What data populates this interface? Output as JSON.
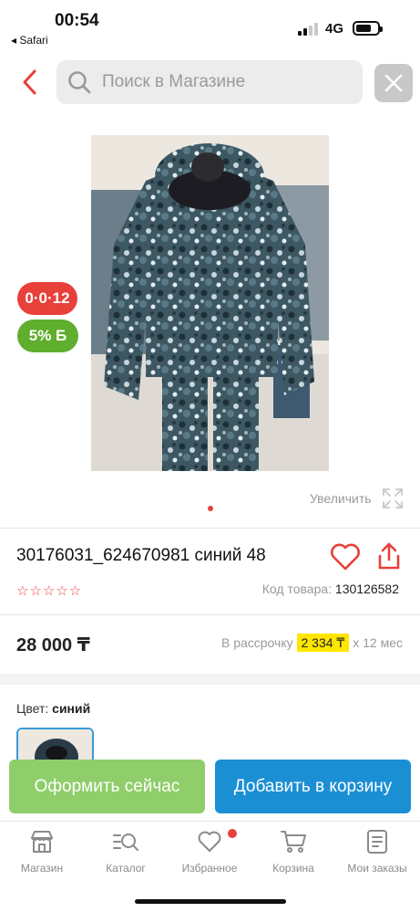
{
  "status_bar": {
    "time": "00:54",
    "back_app": "◂ Safari",
    "network": "4G"
  },
  "search": {
    "placeholder": "Поиск в Магазине"
  },
  "badges": {
    "installment": "0·0·12",
    "bonus": "5% Б"
  },
  "gallery": {
    "zoom_label": "Увеличить"
  },
  "product": {
    "title": "30176031_624670981 синий 48",
    "rating_stars": "☆☆☆☆☆",
    "code_label": "Код товара: ",
    "code_value": "130126582",
    "price": "28 000 ₸",
    "installment_prefix": "В рассрочку ",
    "installment_amount": "2 334 ₸",
    "installment_suffix": " х 12 мес",
    "color_label": "Цвет: ",
    "color_value": "синий"
  },
  "actions": {
    "order_now": "Оформить сейчас",
    "add_to_cart": "Добавить в корзину"
  },
  "tabbar": {
    "items": [
      {
        "label": "Магазин",
        "icon": "shop-icon"
      },
      {
        "label": "Каталог",
        "icon": "catalog-search-icon"
      },
      {
        "label": "Избранное",
        "icon": "heart-icon"
      },
      {
        "label": "Корзина",
        "icon": "cart-icon"
      },
      {
        "label": "Мои заказы",
        "icon": "orders-icon"
      }
    ]
  },
  "colors": {
    "accent_red": "#e8403a",
    "bonus_green": "#5fae2d",
    "order_green": "#8fce6a",
    "cart_blue": "#1b8fd4",
    "highlight_yellow": "#ffe600"
  }
}
